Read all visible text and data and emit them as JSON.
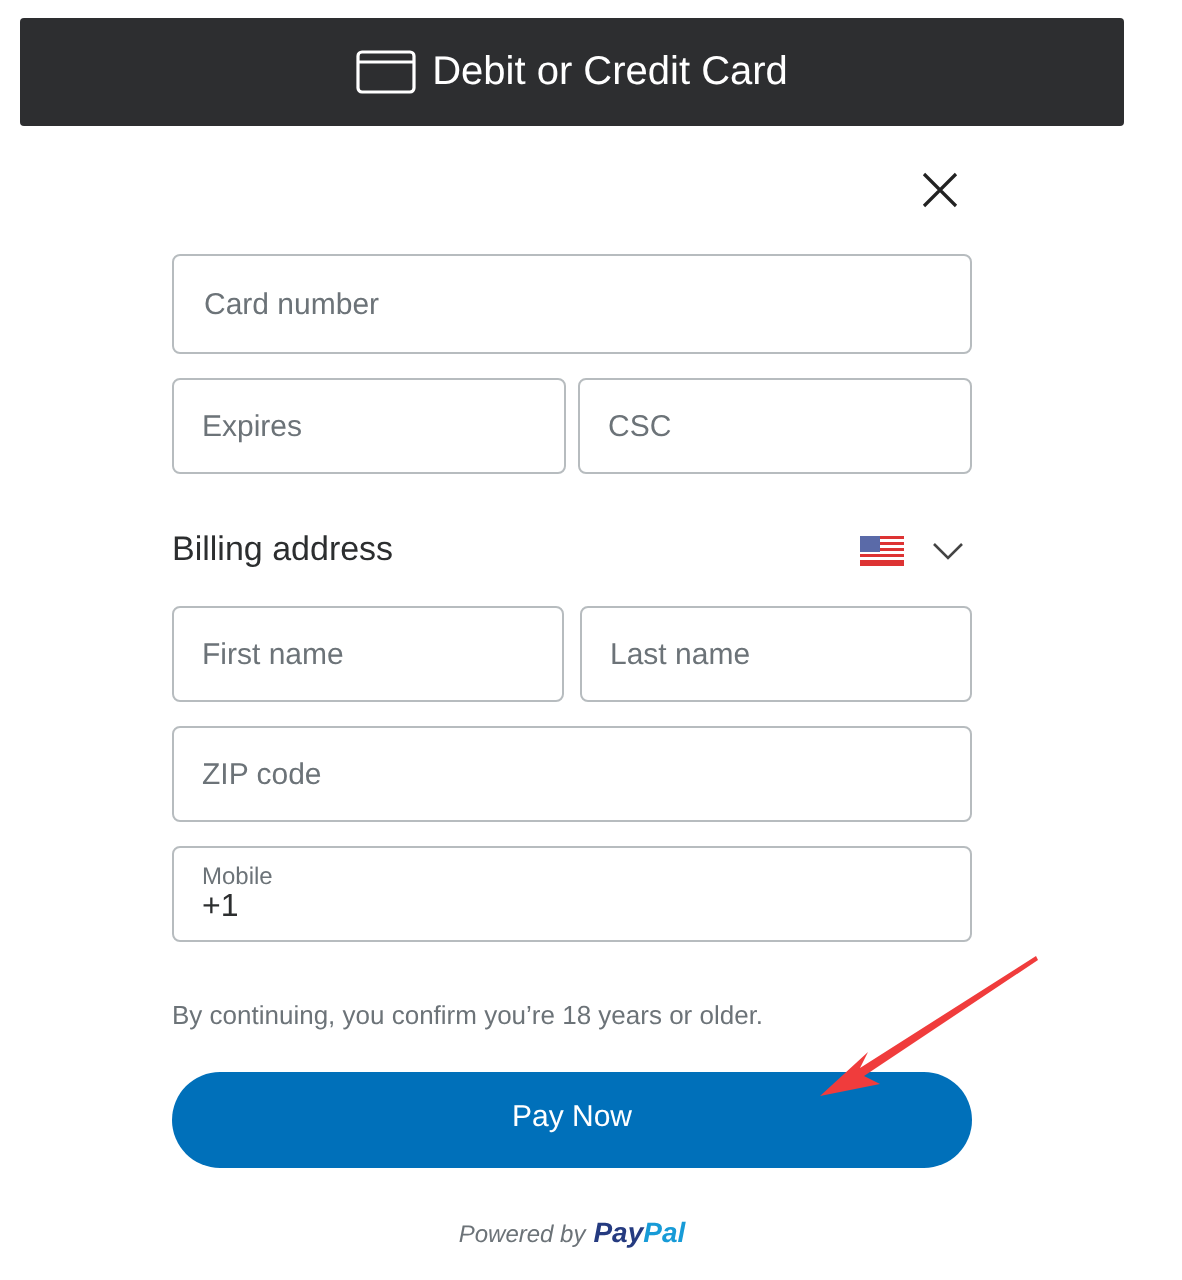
{
  "header": {
    "title": "Debit or Credit Card"
  },
  "card_fields": [
    {
      "placeholder": "Card number"
    },
    {
      "placeholder": "Expires"
    },
    {
      "placeholder": "CSC"
    }
  ],
  "billing": {
    "title": "Billing address"
  },
  "address_fields": [
    {
      "placeholder": "First name"
    },
    {
      "placeholder": "Last name"
    },
    {
      "placeholder": "ZIP code"
    }
  ],
  "mobile": {
    "label": "Mobile",
    "value": "+1"
  },
  "notice": "By continuing, you confirm you’re 18 years or older.",
  "pay_button": "Pay Now",
  "footer": {
    "text": "Powered by",
    "logo_parts": [
      "Pay",
      "Pal"
    ]
  }
}
